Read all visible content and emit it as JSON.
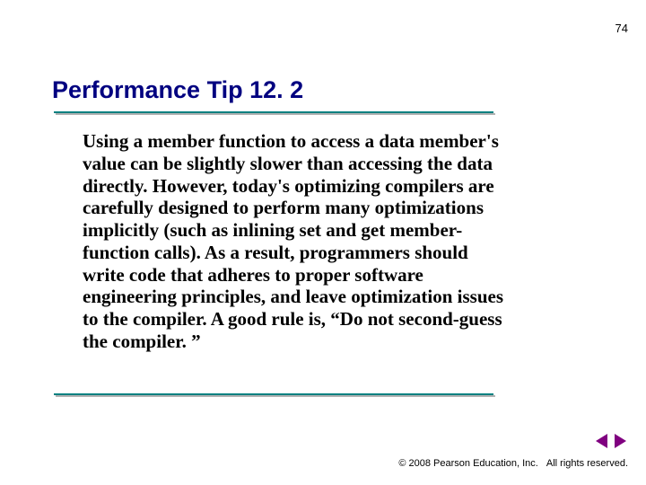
{
  "page_number": "74",
  "title": "Performance Tip 12. 2",
  "body_text": "Using a member function to access a data member's value can be slightly slower than accessing the data directly. However, today's optimizing compilers are carefully designed to perform many optimizations implicitly (such as inlining set and get member-function calls). As a result, programmers should write code that adheres to proper software engineering principles, and leave optimization issues to the compiler. A good rule is, “Do not second-guess the compiler. ”",
  "footer": {
    "copyright": "© 2008 Pearson Education, Inc.",
    "rights": "All rights reserved."
  }
}
